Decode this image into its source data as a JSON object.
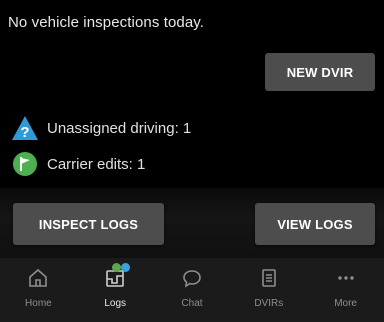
{
  "status": {
    "message": "No vehicle inspections today."
  },
  "actions": {
    "new_dvir": "NEW DVIR",
    "inspect_logs": "INSPECT LOGS",
    "view_logs": "VIEW LOGS"
  },
  "alerts": {
    "unassigned": "Unassigned driving: 1",
    "carrier": "Carrier edits: 1"
  },
  "colors": {
    "button_bg": "#4d4d4d",
    "unassigned_icon": "#2e9bd6",
    "carrier_icon": "#4caf50",
    "badge_green": "#5aa64c",
    "badge_blue": "#3aa0e0"
  },
  "tabs": [
    {
      "label": "Home",
      "icon": "home-icon",
      "active": false
    },
    {
      "label": "Logs",
      "icon": "logs-icon",
      "active": true
    },
    {
      "label": "Chat",
      "icon": "chat-icon",
      "active": false
    },
    {
      "label": "DVIRs",
      "icon": "dvirs-icon",
      "active": false
    },
    {
      "label": "More",
      "icon": "more-icon",
      "active": false
    }
  ]
}
